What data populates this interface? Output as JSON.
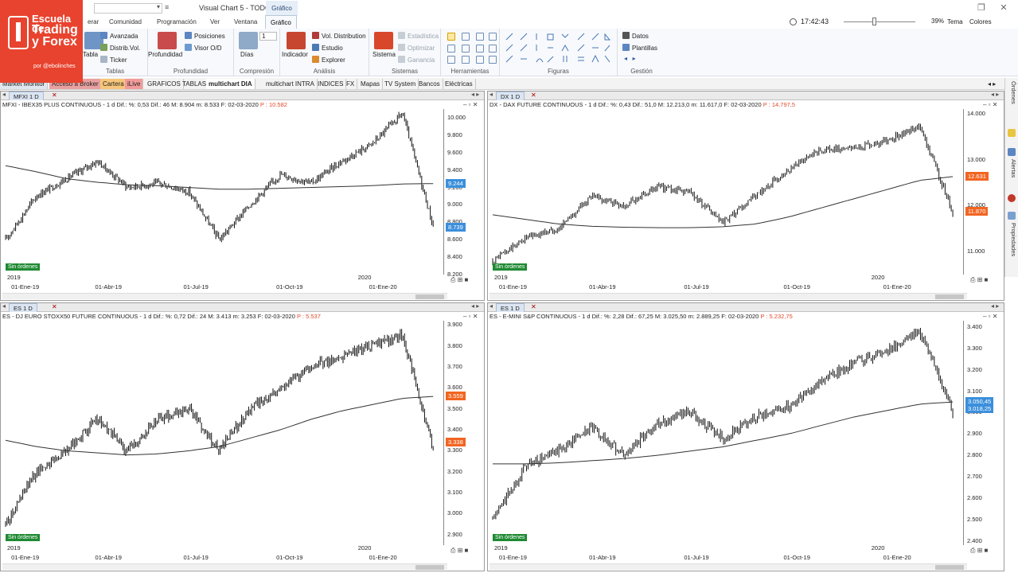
{
  "logo": {
    "line1": "Escuela de",
    "line2": "Trading y Forex",
    "line3": "por @ebolinches"
  },
  "titlebar": {
    "title": "Visual Chart 5 - TODO",
    "context_tab": "Gráfico"
  },
  "clock": "17:42:43",
  "zoom": "39%",
  "tema": "Tema",
  "colores": "Colores",
  "ribbon_tabs": [
    "erar",
    "Comunidad",
    "Programación",
    "Ver",
    "Ventana",
    "Gráfico"
  ],
  "ribbon": {
    "tablas": {
      "label": "Tablas",
      "items": [
        "Avanzada",
        "Distrib.Vol.",
        "Ticker"
      ],
      "big": "Tabla"
    },
    "profundidad": {
      "label": "Profundidad",
      "big": "Profundidad",
      "items": [
        "Posiciones",
        "Visor O/D"
      ]
    },
    "compresion": {
      "label": "Compresión",
      "big": "Días",
      "value": "1"
    },
    "analisis": {
      "label": "Análisis",
      "big": "Indicador",
      "items": [
        "Vol. Distribution",
        "Estudio",
        "Explorer"
      ]
    },
    "sistemas": {
      "label": "Sistemas",
      "big": "Sistema",
      "items": [
        "Estadística",
        "Optimizar",
        "Ganancia"
      ]
    },
    "herramientas": {
      "label": "Herramientas"
    },
    "figuras": {
      "label": "Figuras"
    },
    "gestion": {
      "label": "Gestión",
      "items": [
        "Datos",
        "Plantillas"
      ]
    }
  },
  "workspace_tabs": [
    "Market Monitor",
    "Acceso a Broker",
    "Cartera",
    "iLive",
    "GRAFICOS",
    "TABLAS",
    "multichart DIA",
    "multichart INTRA",
    "INDICES",
    "FX",
    "Mapas",
    "TV System",
    "Bancos",
    "Eléctricas"
  ],
  "sidebar": [
    "Órdenes",
    "Alertas",
    "Propiedades"
  ],
  "panels": [
    {
      "tab": "MFXI 1 D",
      "header": "MFXI - IBEX35 PLUS CONTINUOUS -  1 d  Dif.: %: 0,53  Dif.: 46  M: 8.904  m: 8.533  F: 02-03-2020",
      "price": "P : 10.582",
      "y_ticks": [
        "10.000",
        "9.800",
        "9.600",
        "9.400",
        "9.200",
        "9.000",
        "8.800",
        "8.600",
        "8.400",
        "8.200"
      ],
      "price_boxes": [
        {
          "value": "9.244",
          "color": "blue"
        },
        {
          "value": "8.739",
          "color": "blue"
        }
      ],
      "x_labels": [
        "01-Ene-19",
        "01-Abr-19",
        "01-Jul-19",
        "01-Oct-19",
        "01-Ene-20"
      ],
      "years": [
        "2019",
        "2020"
      ],
      "badge": "Sin órdenes"
    },
    {
      "tab": "DX 1 D",
      "header": "DX - DAX FUTURE CONTINUOUS -  1 d  Dif.: %: 0,43  Dif.: 51,0  M: 12.213,0  m: 11.617,0  F: 02-03-2020",
      "price": "P : 14.797,5",
      "y_ticks": [
        "14.000",
        "13.000",
        "12.000",
        "11.000"
      ],
      "price_boxes": [
        {
          "value": "12.631",
          "color": "orange"
        },
        {
          "value": "11.870",
          "color": "orange"
        }
      ],
      "x_labels": [
        "01-Ene-19",
        "01-Abr-19",
        "01-Jul-19",
        "01-Oct-19",
        "01-Ene-20"
      ],
      "years": [
        "2019",
        "2020"
      ],
      "badge": "Sin órdenes"
    },
    {
      "tab": "ES 1 D",
      "header": "ES - DJ EURO STOXX50 FUTURE CONTINUOUS -  1 d  Dif.: %: 0,72  Dif.: 24  M: 3.413  m: 3.253  F: 02-03-2020",
      "price": "P : 5.537",
      "y_ticks": [
        "3.900",
        "3.800",
        "3.700",
        "3.600",
        "3.500",
        "3.400",
        "3.300",
        "3.200",
        "3.100",
        "3.000",
        "2.900"
      ],
      "price_boxes": [
        {
          "value": "3.559",
          "color": "orange"
        },
        {
          "value": "3.338",
          "color": "orange"
        }
      ],
      "x_labels": [
        "01-Ene-19",
        "01-Abr-19",
        "01-Jul-19",
        "01-Oct-19",
        "01-Ene-20"
      ],
      "years": [
        "2019",
        "2020"
      ],
      "badge": "Sin órdenes"
    },
    {
      "tab": "ES 1 D",
      "header": "ES - E-MINI S&P CONTINUOUS -  1 d  Dif.: %: 2,28  Dif.: 67,25  M: 3.025,50  m: 2.889,25  F: 02-03-2020",
      "price": "P : 5.232,75",
      "y_ticks": [
        "3.400",
        "3.300",
        "3.200",
        "3.100",
        "3.000",
        "2.900",
        "2.800",
        "2.700",
        "2.600",
        "2.500",
        "2.400"
      ],
      "price_boxes": [
        {
          "value": "3.050,45",
          "color": "blue"
        },
        {
          "value": "3.018,25",
          "color": "blue"
        }
      ],
      "x_labels": [
        "01-Ene-19",
        "01-Abr-19",
        "01-Jul-19",
        "01-Oct-19",
        "01-Ene-20"
      ],
      "years": [
        "2019",
        "2020"
      ],
      "badge": "Sin órdenes"
    }
  ],
  "chart_data": [
    {
      "type": "line",
      "title": "IBEX35 PLUS CONTINUOUS",
      "ylim": [
        8200,
        10100
      ],
      "x": [
        "2019-01",
        "2019-02",
        "2019-03",
        "2019-04",
        "2019-05",
        "2019-06",
        "2019-07",
        "2019-08",
        "2019-09",
        "2019-10",
        "2019-11",
        "2019-12",
        "2020-01",
        "2020-02",
        "2020-03"
      ],
      "series": [
        {
          "values": [
            8600,
            9100,
            9300,
            9500,
            9200,
            9250,
            9150,
            8600,
            9000,
            9350,
            9250,
            9500,
            9700,
            10050,
            8750
          ]
        },
        {
          "values": [
            9450,
            9380,
            9300,
            9260,
            9230,
            9220,
            9200,
            9180,
            9180,
            9190,
            9200,
            9210,
            9220,
            9240,
            9244
          ]
        }
      ]
    },
    {
      "type": "line",
      "title": "DAX FUTURE CONTINUOUS",
      "ylim": [
        10500,
        14100
      ],
      "x": [
        "2019-01",
        "2019-02",
        "2019-03",
        "2019-04",
        "2019-05",
        "2019-06",
        "2019-07",
        "2019-08",
        "2019-09",
        "2019-10",
        "2019-11",
        "2019-12",
        "2020-01",
        "2020-02",
        "2020-03"
      ],
      "series": [
        {
          "values": [
            10800,
            11300,
            11500,
            12200,
            12000,
            12400,
            12300,
            11600,
            12200,
            12800,
            13200,
            13250,
            13400,
            13750,
            11850
          ]
        },
        {
          "values": [
            11800,
            11700,
            11600,
            11550,
            11530,
            11520,
            11520,
            11540,
            11600,
            11750,
            11950,
            12150,
            12350,
            12550,
            12631
          ]
        }
      ]
    },
    {
      "type": "line",
      "title": "DJ EURO STOXX50 FUTURE CONTINUOUS",
      "ylim": [
        2850,
        3920
      ],
      "x": [
        "2019-01",
        "2019-02",
        "2019-03",
        "2019-04",
        "2019-05",
        "2019-06",
        "2019-07",
        "2019-08",
        "2019-09",
        "2019-10",
        "2019-11",
        "2019-12",
        "2020-01",
        "2020-02",
        "2020-03"
      ],
      "series": [
        {
          "values": [
            2950,
            3200,
            3300,
            3450,
            3300,
            3450,
            3500,
            3300,
            3500,
            3600,
            3700,
            3750,
            3800,
            3850,
            3300
          ]
        },
        {
          "values": [
            3350,
            3320,
            3300,
            3290,
            3280,
            3285,
            3300,
            3320,
            3360,
            3400,
            3450,
            3490,
            3520,
            3550,
            3559
          ]
        }
      ]
    },
    {
      "type": "line",
      "title": "E-MINI S&P CONTINUOUS",
      "ylim": [
        2380,
        3430
      ],
      "x": [
        "2019-01",
        "2019-02",
        "2019-03",
        "2019-04",
        "2019-05",
        "2019-06",
        "2019-07",
        "2019-08",
        "2019-09",
        "2019-10",
        "2019-11",
        "2019-12",
        "2020-01",
        "2020-02",
        "2020-03"
      ],
      "series": [
        {
          "values": [
            2500,
            2750,
            2820,
            2930,
            2800,
            2950,
            3000,
            2880,
            2980,
            3030,
            3150,
            3230,
            3290,
            3380,
            3000
          ]
        },
        {
          "values": [
            2760,
            2760,
            2765,
            2775,
            2785,
            2800,
            2820,
            2840,
            2870,
            2900,
            2940,
            2980,
            3010,
            3040,
            3050
          ]
        }
      ]
    }
  ]
}
